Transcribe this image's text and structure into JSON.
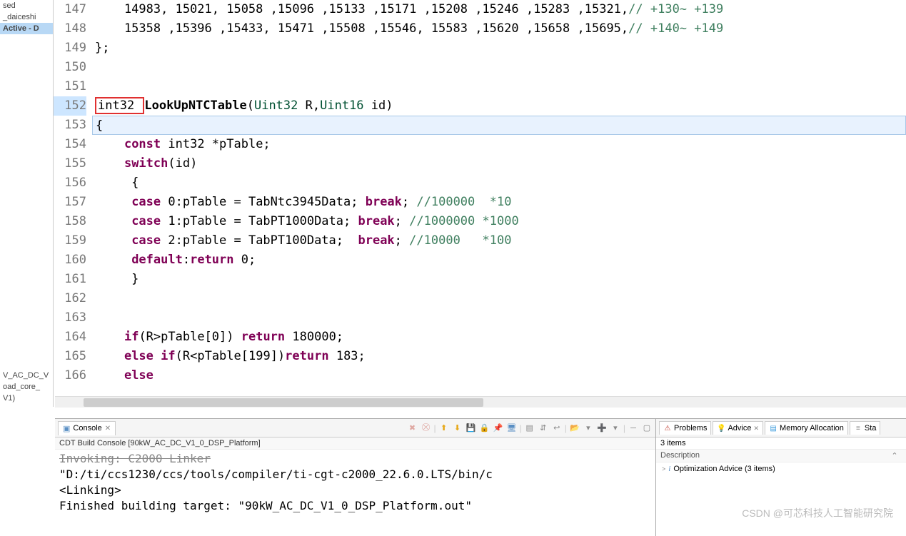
{
  "sidebar": {
    "items": [
      {
        "label": "sed"
      },
      {
        "label": "_daiceshi"
      },
      {
        "label": "Active - D",
        "active": true
      }
    ],
    "bottom": [
      {
        "label": "V_AC_DC_V"
      },
      {
        "label": "oad_core_"
      },
      {
        "label": "V1)"
      }
    ]
  },
  "code": {
    "lines": [
      {
        "n": 147,
        "html": "    14983, 15021, 15058 ,15096 ,15133 ,15171 ,15208 ,15246 ,15283 ,15321,<span class='comment'>// +130~ +139</span>"
      },
      {
        "n": 148,
        "html": "    15358 ,15396 ,15433, 15471 ,15508 ,15546, 15583 ,15620 ,15658 ,15695,<span class='comment'>// +140~ +149</span>"
      },
      {
        "n": 149,
        "html": "};"
      },
      {
        "n": 150,
        "html": ""
      },
      {
        "n": 151,
        "html": ""
      },
      {
        "n": 152,
        "html": "<span class='red-box'>int32 </span><span class='fn'>LookUpNTCTable</span>(<span class='type'>Uint32</span> R,<span class='type'>Uint16</span> id)",
        "marked": true
      },
      {
        "n": 153,
        "html": "{",
        "highlighted": true
      },
      {
        "n": 154,
        "html": "    <span class='kw'>const</span> int32 *pTable;"
      },
      {
        "n": 155,
        "html": "    <span class='kw'>switch</span>(id)"
      },
      {
        "n": 156,
        "html": "     {"
      },
      {
        "n": 157,
        "html": "     <span class='kw'>case</span> 0:pTable = TabNtc3945Data; <span class='kw'>break</span>; <span class='comment'>//100000  *10</span>"
      },
      {
        "n": 158,
        "html": "     <span class='kw'>case</span> 1:pTable = TabPT1000Data; <span class='kw'>break</span>; <span class='comment'>//1000000 *1000</span>"
      },
      {
        "n": 159,
        "html": "     <span class='kw'>case</span> 2:pTable = TabPT100Data;  <span class='kw'>break</span>; <span class='comment'>//10000   *100</span>"
      },
      {
        "n": 160,
        "html": "     <span class='kw'>default</span>:<span class='kw'>return</span> 0;"
      },
      {
        "n": 161,
        "html": "     }"
      },
      {
        "n": 162,
        "html": ""
      },
      {
        "n": 163,
        "html": ""
      },
      {
        "n": 164,
        "html": "    <span class='kw'>if</span>(R&gt;pTable[0]) <span class='kw'>return</span> 180000;"
      },
      {
        "n": 165,
        "html": "    <span class='kw'>else</span> <span class='kw'>if</span>(R&lt;pTable[199])<span class='kw'>return</span> 183;"
      },
      {
        "n": 166,
        "html": "    <span class='kw'>else</span>"
      }
    ]
  },
  "console": {
    "tab": "Console",
    "subheader": "CDT Build Console [90kW_AC_DC_V1_0_DSP_Platform]",
    "output": [
      {
        "text": "Invoking: C2000 Linker",
        "strike": true
      },
      {
        "text": "\"D:/ti/ccs1230/ccs/tools/compiler/ti-cgt-c2000_22.6.0.LTS/bin/c"
      },
      {
        "text": "<Linking>"
      },
      {
        "text": "Finished building target: \"90kW_AC_DC_V1_0_DSP_Platform.out\""
      }
    ]
  },
  "rightPanel": {
    "tabs": [
      {
        "label": "Problems",
        "icon": "⚠",
        "iconColor": "#c0392b"
      },
      {
        "label": "Advice",
        "icon": "💡",
        "iconColor": "#f1c40f",
        "active": true
      },
      {
        "label": "Memory Allocation",
        "icon": "▤",
        "iconColor": "#3498db"
      },
      {
        "label": "Sta",
        "icon": "≡",
        "iconColor": "#888"
      }
    ],
    "itemsCount": "3 items",
    "descHeader": "Description",
    "tree": [
      {
        "expand": ">",
        "icon": "i",
        "label": "Optimization Advice (3 items)"
      }
    ]
  },
  "watermark": "CSDN @可芯科技人工智能研究院"
}
